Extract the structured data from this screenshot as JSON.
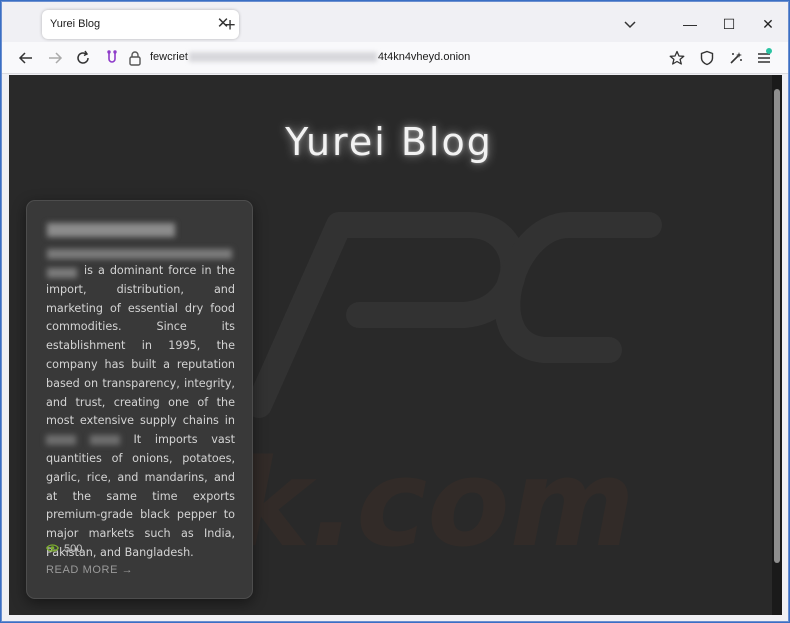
{
  "browser": {
    "tab_title": "Yurei Blog",
    "tab_close_glyph": "✕",
    "new_tab_glyph": "+",
    "url_prefix": "fewcriet",
    "url_suffix": "4t4kn4vheyd.onion",
    "minimize_glyph": "—",
    "maximize_glyph": "☐",
    "close_glyph": "✕",
    "icons": [
      "back-arrow-icon",
      "forward-arrow-icon",
      "reload-icon",
      "tor-circuit-icon",
      "lock-icon",
      "bookmark-star-icon",
      "shield-icon",
      "security-level-icon",
      "menu-icon"
    ]
  },
  "page": {
    "title": "Yurei Blog",
    "post": {
      "excerpt": "is a dominant force in the import, distribution, and marketing of essential dry food commodities. Since its establishment in 1995, the company has built a reputation based on transparency, integrity, and trust, creating one of the most extensive supply chains in",
      "excerpt_continued": "It imports vast quantities of onions, potatoes, garlic, rice, and mandarins, and at the same time exports premium-grade black pepper to major markets such as India, Pakistan, and Bangladesh.",
      "views": "500",
      "read_more": "READ MORE →"
    },
    "watermark": "PCrisk.com"
  },
  "colors": {
    "page_bg": "#292929",
    "card_bg": "#393939",
    "eye_icon": "#7cae2e",
    "title": "#f2f2f2",
    "window_frame": "#3a6fc4"
  }
}
